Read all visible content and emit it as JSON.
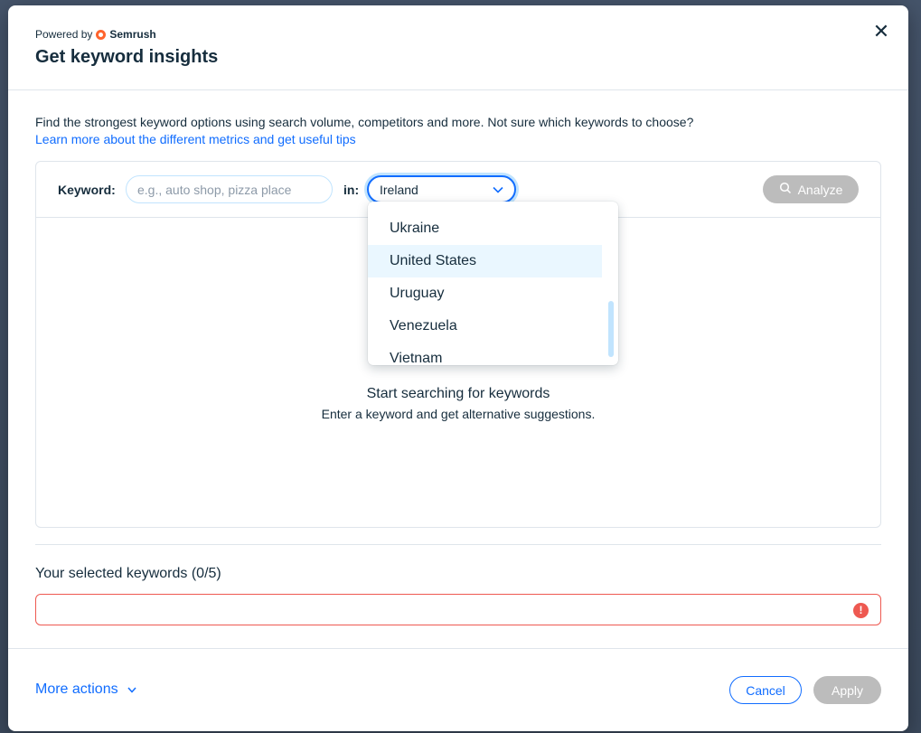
{
  "header": {
    "powered_by": "Powered by",
    "brand": "Semrush",
    "title": "Get keyword insights",
    "close_icon": "close-icon"
  },
  "description": {
    "text": "Find the strongest keyword options using search volume, competitors and more. Not sure which keywords to choose?",
    "link": "Learn more about the different metrics and get useful tips"
  },
  "search": {
    "keyword_label": "Keyword:",
    "keyword_placeholder": "e.g., auto shop, pizza place",
    "keyword_value": "",
    "in_label": "in:",
    "country_selected": "Ireland",
    "analyze_label": "Analyze"
  },
  "empty_state": {
    "title": "Start searching for keywords",
    "subtitle": "Enter a keyword and get alternative suggestions."
  },
  "dropdown": {
    "options": [
      {
        "label": "Ukraine"
      },
      {
        "label": "United States"
      },
      {
        "label": "Uruguay"
      },
      {
        "label": "Venezuela"
      },
      {
        "label": "Vietnam"
      }
    ],
    "highlighted": "United States"
  },
  "selected": {
    "label": "Your selected keywords (0/5)"
  },
  "footer": {
    "more_actions": "More actions",
    "cancel": "Cancel",
    "apply": "Apply"
  },
  "colors": {
    "accent": "#116dff",
    "error": "#ee5951",
    "disabled": "#bcbcbc",
    "highlight": "#eaf7ff",
    "brand_semrush": "#ff642d"
  }
}
